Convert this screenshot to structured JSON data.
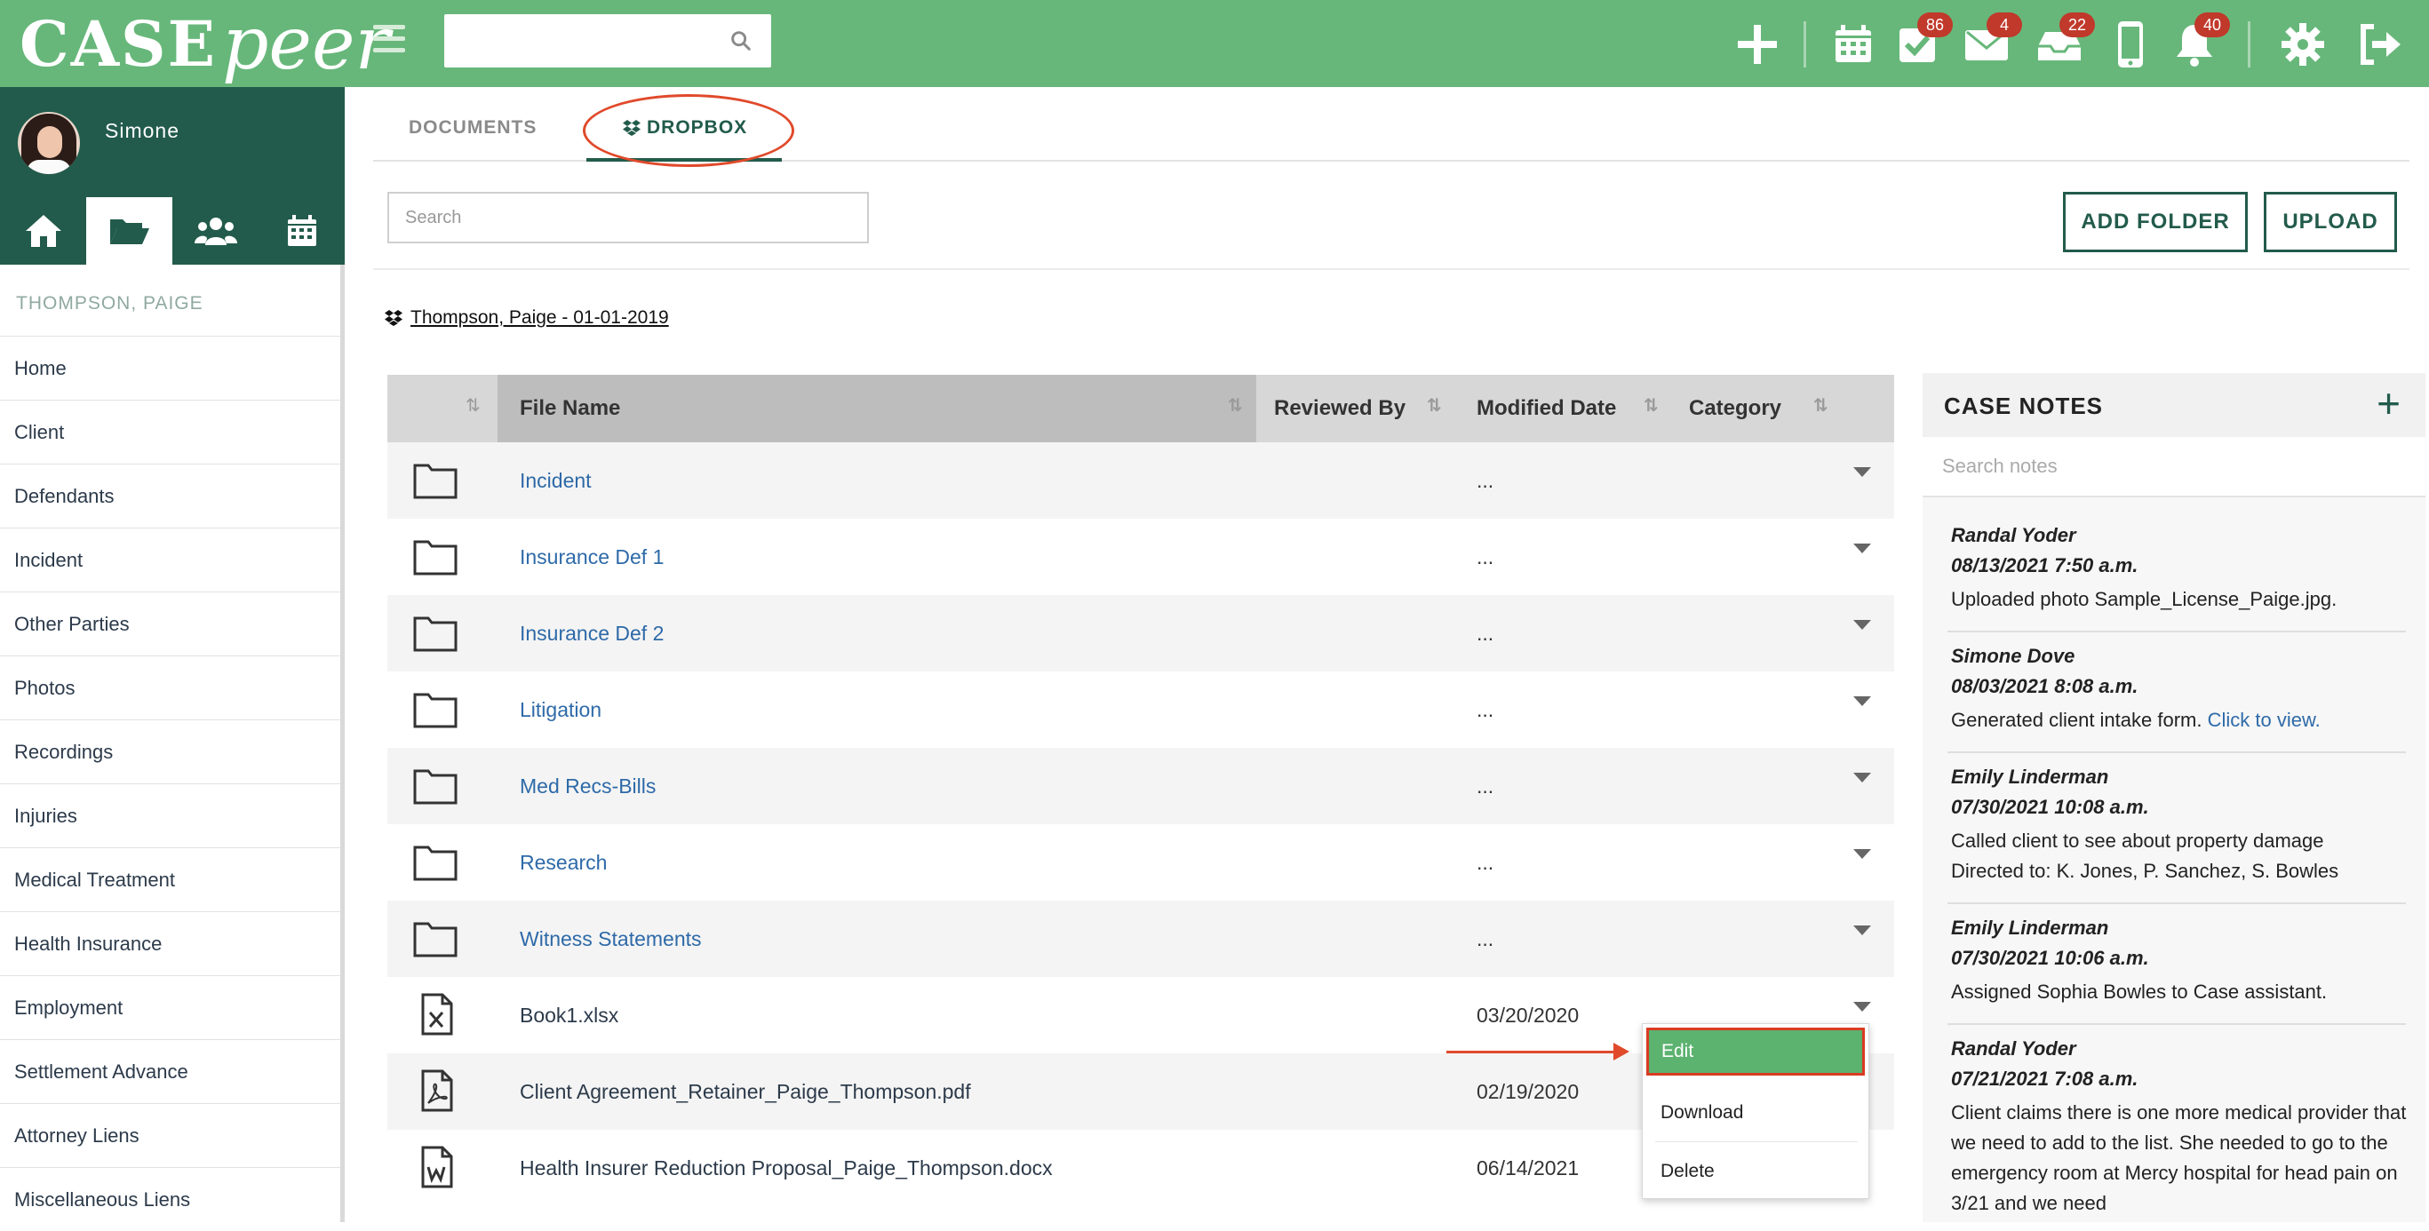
{
  "app": {
    "logo_case": "CASE",
    "logo_peer": "peer"
  },
  "topbar": {
    "badges": {
      "tasks": "86",
      "mail": "4",
      "inbox": "22",
      "notifications": "40"
    },
    "accent": "#67b77a"
  },
  "user": {
    "name": "Simone"
  },
  "sidebar": {
    "case_name": "THOMPSON, PAIGE",
    "items": [
      {
        "label": "Home"
      },
      {
        "label": "Client"
      },
      {
        "label": "Defendants"
      },
      {
        "label": "Incident"
      },
      {
        "label": "Other Parties"
      },
      {
        "label": "Photos"
      },
      {
        "label": "Recordings"
      },
      {
        "label": "Injuries"
      },
      {
        "label": "Medical Treatment"
      },
      {
        "label": "Health Insurance"
      },
      {
        "label": "Employment"
      },
      {
        "label": "Settlement Advance"
      },
      {
        "label": "Attorney Liens"
      },
      {
        "label": "Miscellaneous Liens"
      }
    ],
    "dark_color": "#225b4b"
  },
  "tabs": {
    "documents": "DOCUMENTS",
    "dropbox": "DROPBOX"
  },
  "toolbar": {
    "search_placeholder": "Search",
    "add_folder": "ADD FOLDER",
    "upload": "UPLOAD"
  },
  "breadcrumb": "Thompson, Paige - 01-01-2019",
  "table": {
    "columns": [
      "File Name",
      "Reviewed By",
      "Modified Date",
      "Category"
    ],
    "rows": [
      {
        "type": "folder",
        "name": "Incident",
        "modified": "..."
      },
      {
        "type": "folder",
        "name": "Insurance Def 1",
        "modified": "..."
      },
      {
        "type": "folder",
        "name": "Insurance Def 2",
        "modified": "..."
      },
      {
        "type": "folder",
        "name": "Litigation",
        "modified": "..."
      },
      {
        "type": "folder",
        "name": "Med Recs-Bills",
        "modified": "..."
      },
      {
        "type": "folder",
        "name": "Research",
        "modified": "..."
      },
      {
        "type": "folder",
        "name": "Witness Statements",
        "modified": "..."
      },
      {
        "type": "xlsx",
        "name": "Book1.xlsx",
        "modified": "03/20/2020"
      },
      {
        "type": "pdf",
        "name": "Client Agreement_Retainer_Paige_Thompson.pdf",
        "modified": "02/19/2020"
      },
      {
        "type": "docx",
        "name": "Health Insurer Reduction Proposal_Paige_Thompson.docx",
        "modified": "06/14/2021"
      }
    ]
  },
  "dropdown": {
    "edit": "Edit",
    "download": "Download",
    "delete": "Delete"
  },
  "notes": {
    "title": "CASE NOTES",
    "add": "+",
    "search_placeholder": "Search notes",
    "items": [
      {
        "author": "Randal Yoder",
        "date": "08/13/2021 7:50 a.m.",
        "text": "Uploaded photo Sample_License_Paige.jpg."
      },
      {
        "author": "Simone Dove",
        "date": "08/03/2021 8:08 a.m.",
        "text": "Generated client intake form.",
        "link": "Click to view."
      },
      {
        "author": "Emily Linderman",
        "date": "07/30/2021 10:08 a.m.",
        "text": "Called client to see about property damage",
        "text2": "Directed to: K. Jones, P. Sanchez, S. Bowles"
      },
      {
        "author": "Emily Linderman",
        "date": "07/30/2021 10:06 a.m.",
        "text": "Assigned Sophia Bowles to Case assistant."
      },
      {
        "author": "Randal Yoder",
        "date": "07/21/2021 7:08 a.m.",
        "text": "Client claims there is one more medical provider that we need to add to the list.  She needed to go to the emergency room at Mercy hospital for head pain on 3/21 and we need"
      }
    ]
  }
}
